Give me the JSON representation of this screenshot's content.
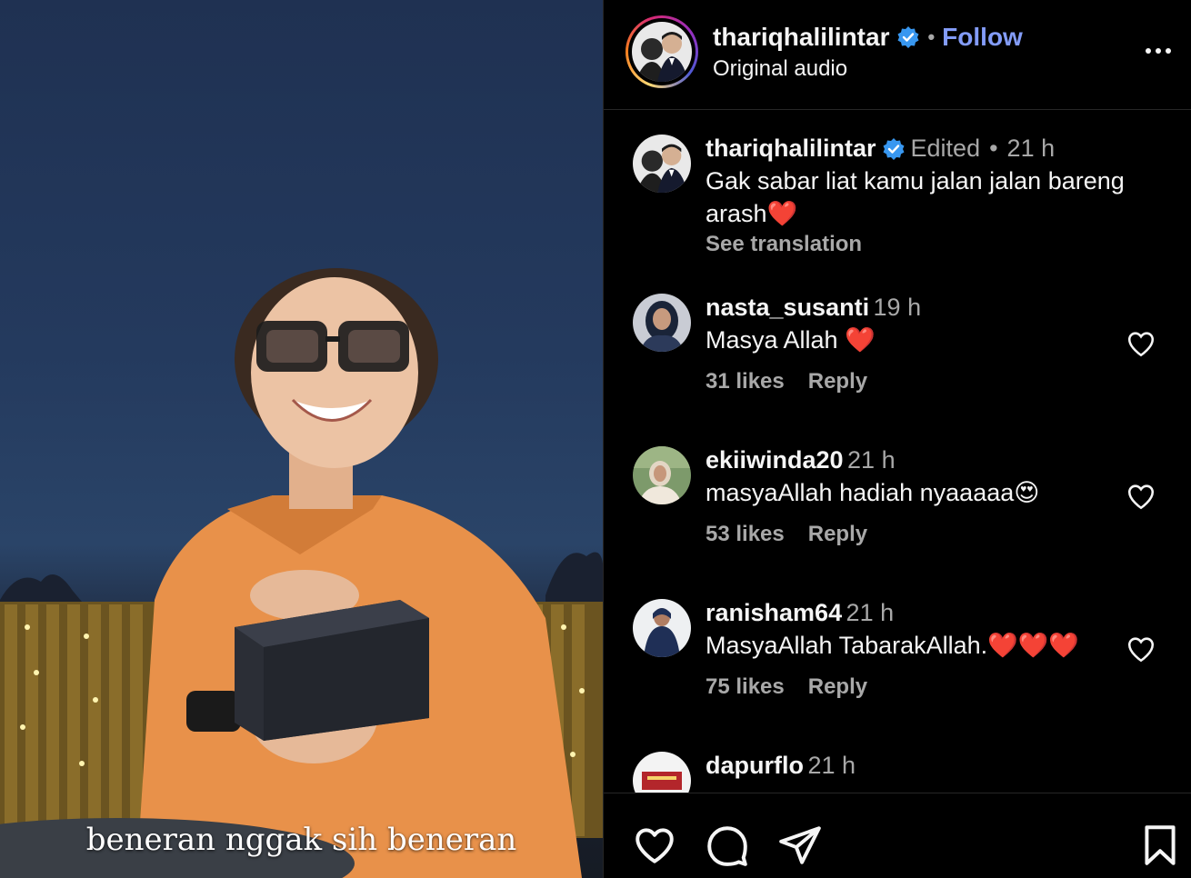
{
  "media": {
    "caption": "beneran nggak sih beneran"
  },
  "header": {
    "username": "thariqhalilintar",
    "separator": "•",
    "follow_label": "Follow",
    "audio": "Original audio",
    "ring_colors": [
      "#feda75",
      "#fa7e1e",
      "#d62976",
      "#962fbf",
      "#4f5bd5"
    ],
    "verified_color": "#3897f0"
  },
  "post_caption": {
    "username": "thariqhalilintar",
    "edited": "Edited",
    "dot": "•",
    "time": "21 h",
    "text": "Gak sabar liat kamu jalan jalan bareng arash",
    "emoji": "❤️",
    "see_translation": "See translation"
  },
  "comments": [
    {
      "username": "nasta_susanti",
      "time": "19 h",
      "text": "Masya Allah ",
      "emoji": "❤️",
      "likes": "31 likes",
      "reply": "Reply"
    },
    {
      "username": "ekiiwinda20",
      "time": "21 h",
      "text": "masyaAllah hadiah nyaaaaa",
      "emoji": "😍",
      "likes": "53 likes",
      "reply": "Reply"
    },
    {
      "username": "ranisham64",
      "time": "21 h",
      "text": "MasyaAllah TabarakAllah.",
      "emoji": "❤️❤️❤️",
      "likes": "75 likes",
      "reply": "Reply"
    },
    {
      "username": "dapurflo",
      "time": "21 h",
      "text": "",
      "emoji": "",
      "likes": "",
      "reply": ""
    }
  ],
  "footer": {
    "icons": [
      "heart-icon",
      "comment-icon",
      "share-icon",
      "bookmark-icon"
    ]
  }
}
